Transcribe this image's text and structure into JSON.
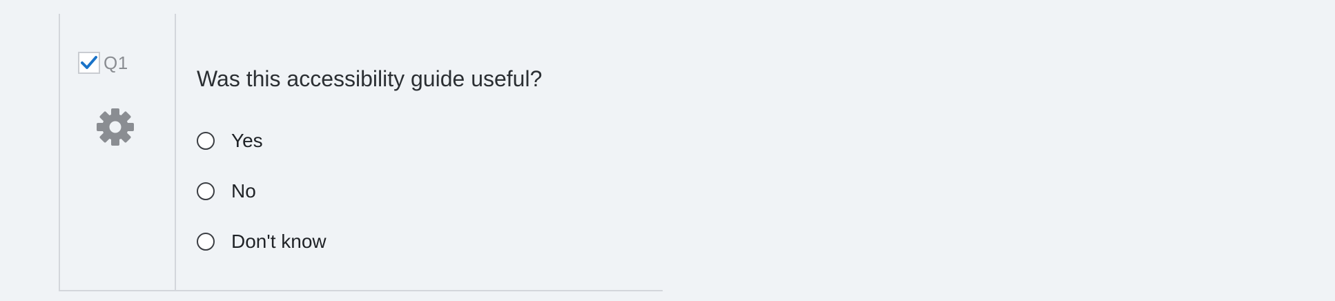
{
  "question": {
    "number": "Q1",
    "selected": true,
    "text": "Was this accessibility guide useful?",
    "choices": [
      {
        "label": "Yes"
      },
      {
        "label": "No"
      },
      {
        "label": "Don't know"
      }
    ]
  },
  "icons": {
    "checkbox_check": "check-icon",
    "settings": "gear-icon",
    "choice_marker": "radio-circle"
  },
  "colors": {
    "background": "#f0f3f6",
    "check": "#1a73c8",
    "gear": "#8a8d92",
    "divider": "#d3d6db",
    "question_text": "#2b2f33"
  }
}
